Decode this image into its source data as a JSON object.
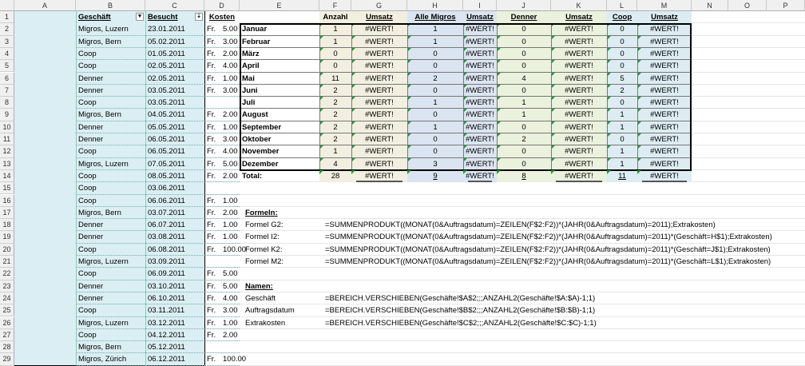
{
  "columns": [
    "A",
    "B",
    "C",
    "D",
    "E",
    "F",
    "G",
    "H",
    "I",
    "J",
    "K",
    "L",
    "M",
    "N",
    "O",
    "P"
  ],
  "rows": [
    "1",
    "2",
    "3",
    "4",
    "5",
    "6",
    "7",
    "8",
    "9",
    "10",
    "11",
    "12",
    "13",
    "14",
    "15",
    "16",
    "17",
    "18",
    "19",
    "20",
    "21",
    "22",
    "23",
    "24",
    "25",
    "26",
    "27",
    "28",
    "29"
  ],
  "headers": {
    "geschaeft": "Geschäft",
    "besucht": "Besucht",
    "kosten": "Kosten"
  },
  "orders": [
    {
      "shop": "Migros, Luzern",
      "date": "23.01.2011",
      "cur": "Fr.",
      "amount": "5.00"
    },
    {
      "shop": "Migros, Bern",
      "date": "05.02.2011",
      "cur": "Fr.",
      "amount": "3.00"
    },
    {
      "shop": "Coop",
      "date": "01.05.2011",
      "cur": "Fr.",
      "amount": "2.00"
    },
    {
      "shop": "Coop",
      "date": "02.05.2011",
      "cur": "Fr.",
      "amount": "4.00"
    },
    {
      "shop": "Denner",
      "date": "02.05.2011",
      "cur": "Fr.",
      "amount": "1.00"
    },
    {
      "shop": "Denner",
      "date": "03.05.2011",
      "cur": "Fr.",
      "amount": "3.00"
    },
    {
      "shop": "Coop",
      "date": "03.05.2011",
      "cur": "",
      "amount": ""
    },
    {
      "shop": "Migros, Bern",
      "date": "04.05.2011",
      "cur": "Fr.",
      "amount": "2.00"
    },
    {
      "shop": "Denner",
      "date": "05.05.2011",
      "cur": "Fr.",
      "amount": "1.00"
    },
    {
      "shop": "Denner",
      "date": "06.05.2011",
      "cur": "Fr.",
      "amount": "3.00"
    },
    {
      "shop": "Coop",
      "date": "06.05.2011",
      "cur": "Fr.",
      "amount": "4.00"
    },
    {
      "shop": "Migros, Luzern",
      "date": "07.05.2011",
      "cur": "Fr.",
      "amount": "5.00"
    },
    {
      "shop": "Coop",
      "date": "08.05.2011",
      "cur": "Fr.",
      "amount": "2.00"
    },
    {
      "shop": "Coop",
      "date": "03.06.2011",
      "cur": "",
      "amount": ""
    },
    {
      "shop": "Coop",
      "date": "06.06.2011",
      "cur": "Fr.",
      "amount": "1.00"
    },
    {
      "shop": "Migros, Bern",
      "date": "03.07.2011",
      "cur": "Fr.",
      "amount": "2.00"
    },
    {
      "shop": "Denner",
      "date": "06.07.2011",
      "cur": "Fr.",
      "amount": "1.00"
    },
    {
      "shop": "Denner",
      "date": "03.08.2011",
      "cur": "Fr.",
      "amount": "1.00"
    },
    {
      "shop": "Coop",
      "date": "06.08.2011",
      "cur": "Fr.",
      "amount": "100.00"
    },
    {
      "shop": "Migros, Luzern",
      "date": "03.09.2011",
      "cur": "",
      "amount": ""
    },
    {
      "shop": "Coop",
      "date": "06.09.2011",
      "cur": "Fr.",
      "amount": "5.00"
    },
    {
      "shop": "Denner",
      "date": "03.10.2011",
      "cur": "Fr.",
      "amount": "5.00"
    },
    {
      "shop": "Denner",
      "date": "06.10.2011",
      "cur": "Fr.",
      "amount": "4.00"
    },
    {
      "shop": "Coop",
      "date": "03.11.2011",
      "cur": "Fr.",
      "amount": "3.00"
    },
    {
      "shop": "Migros, Luzern",
      "date": "03.12.2011",
      "cur": "Fr.",
      "amount": "1.00"
    },
    {
      "shop": "Coop",
      "date": "04.12.2011",
      "cur": "Fr.",
      "amount": "2.00"
    },
    {
      "shop": "Migros, Bern",
      "date": "05.12.2011",
      "cur": "",
      "amount": ""
    },
    {
      "shop": "Migros, Zürich",
      "date": "06.12.2011",
      "cur": "Fr.",
      "amount": "100.00"
    }
  ],
  "summary_headers": [
    "Anzahl",
    "Umsatz",
    "Alle Migros",
    "Umsatz",
    "Denner",
    "Umsatz",
    "Coop",
    "Umsatz"
  ],
  "summary": [
    {
      "month": "Januar",
      "v": [
        "1",
        "#WERT!",
        "1",
        "#WERT!",
        "0",
        "#WERT!",
        "0",
        "#WERT!"
      ]
    },
    {
      "month": "Februar",
      "v": [
        "1",
        "#WERT!",
        "1",
        "#WERT!",
        "0",
        "#WERT!",
        "0",
        "#WERT!"
      ]
    },
    {
      "month": "März",
      "v": [
        "0",
        "#WERT!",
        "0",
        "#WERT!",
        "0",
        "#WERT!",
        "0",
        "#WERT!"
      ]
    },
    {
      "month": "April",
      "v": [
        "0",
        "#WERT!",
        "0",
        "#WERT!",
        "0",
        "#WERT!",
        "0",
        "#WERT!"
      ]
    },
    {
      "month": "Mai",
      "v": [
        "11",
        "#WERT!",
        "2",
        "#WERT!",
        "4",
        "#WERT!",
        "5",
        "#WERT!"
      ]
    },
    {
      "month": "Juni",
      "v": [
        "2",
        "#WERT!",
        "0",
        "#WERT!",
        "0",
        "#WERT!",
        "2",
        "#WERT!"
      ]
    },
    {
      "month": "Juli",
      "v": [
        "2",
        "#WERT!",
        "1",
        "#WERT!",
        "1",
        "#WERT!",
        "0",
        "#WERT!"
      ]
    },
    {
      "month": "August",
      "v": [
        "2",
        "#WERT!",
        "0",
        "#WERT!",
        "1",
        "#WERT!",
        "1",
        "#WERT!"
      ]
    },
    {
      "month": "September",
      "v": [
        "2",
        "#WERT!",
        "1",
        "#WERT!",
        "0",
        "#WERT!",
        "1",
        "#WERT!"
      ]
    },
    {
      "month": "Oktober",
      "v": [
        "2",
        "#WERT!",
        "0",
        "#WERT!",
        "2",
        "#WERT!",
        "0",
        "#WERT!"
      ]
    },
    {
      "month": "November",
      "v": [
        "1",
        "#WERT!",
        "0",
        "#WERT!",
        "0",
        "#WERT!",
        "1",
        "#WERT!"
      ]
    },
    {
      "month": "Dezember",
      "v": [
        "4",
        "#WERT!",
        "3",
        "#WERT!",
        "0",
        "#WERT!",
        "1",
        "#WERT!"
      ]
    }
  ],
  "total": {
    "label": "Total:",
    "v": [
      "28",
      "#WERT!",
      "9",
      "#WERT!",
      "8",
      "#WERT!",
      "11",
      "#WERT!"
    ]
  },
  "formeln": {
    "title": "Formeln:",
    "items": [
      {
        "label": "Formel G2:",
        "text": "=SUMMENPRODUKT((MONAT(0&Auftragsdatum)=ZEILEN(F$2:F2))*(JAHR(0&Auftragsdatum)=2011);Extrakosten)"
      },
      {
        "label": "Formel I2:",
        "text": "=SUMMENPRODUKT((MONAT(0&Auftragsdatum)=ZEILEN(F$2:F2))*(JAHR(0&Auftragsdatum)=2011)*(Geschäft=H$1);Extrakosten)"
      },
      {
        "label": "Formel K2:",
        "text": "=SUMMENPRODUKT((MONAT(0&Auftragsdatum)=ZEILEN(F$2:F2))*(JAHR(0&Auftragsdatum)=2011)*(Geschäft=J$1);Extrakosten)"
      },
      {
        "label": "Formel M2:",
        "text": "=SUMMENPRODUKT((MONAT(0&Auftragsdatum)=ZEILEN(F$2:F2))*(JAHR(0&Auftragsdatum)=2011)*(Geschäft=L$1);Extrakosten)"
      }
    ]
  },
  "namen": {
    "title": "Namen:",
    "items": [
      {
        "label": "Geschäft",
        "text": "=BEREICH.VERSCHIEBEN(Geschäfte!$A$2;;;ANZAHL2(Geschäfte!$A:$A)-1;1)"
      },
      {
        "label": "Auftragsdatum",
        "text": "=BEREICH.VERSCHIEBEN(Geschäfte!$B$2;;;ANZAHL2(Geschäfte!$B:$B)-1;1)"
      },
      {
        "label": "Extrakosten",
        "text": "=BEREICH.VERSCHIEBEN(Geschäfte!$C$2;;;ANZAHL2(Geschäfte!$C:$C)-1;1)"
      }
    ]
  }
}
